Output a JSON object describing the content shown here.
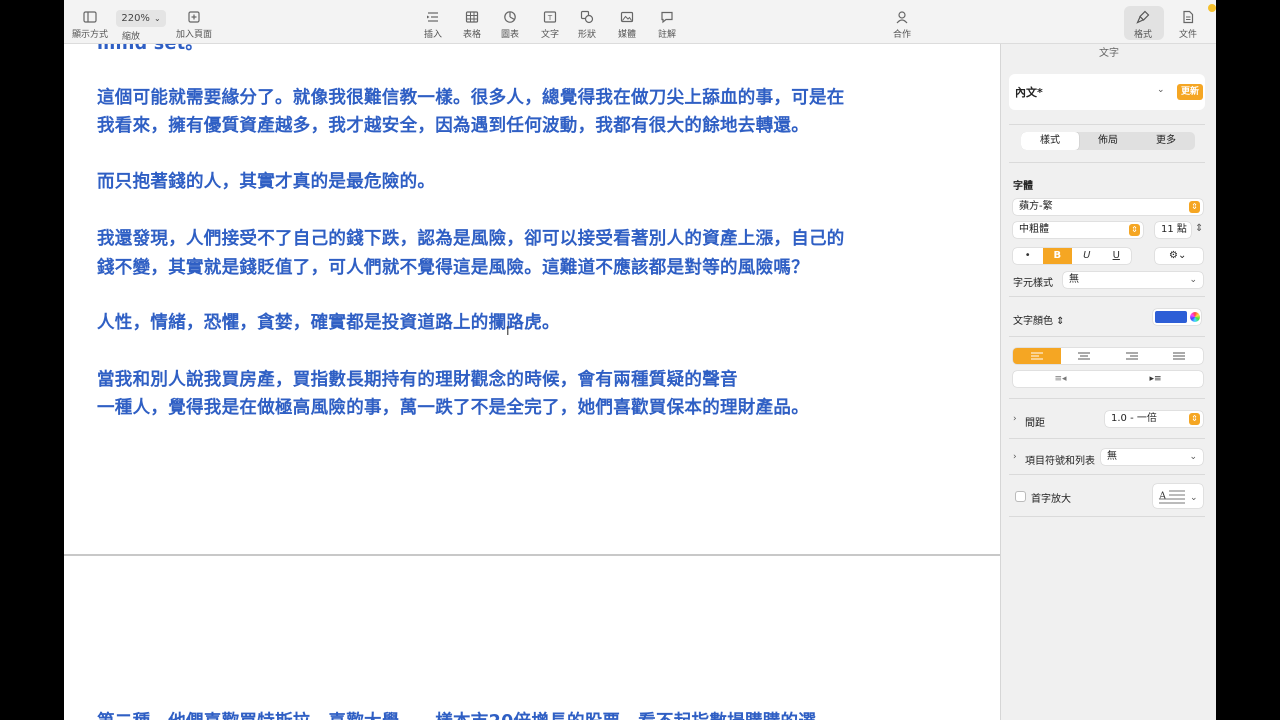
{
  "toolbar": {
    "zoom": "220%",
    "items": {
      "view": "顯示方式",
      "zoom": "縮放",
      "add_page": "加入頁面",
      "insert": "插入",
      "table": "表格",
      "chart": "圖表",
      "text": "文字",
      "shape": "形狀",
      "media": "媒體",
      "comment": "註解",
      "collaborate": "合作",
      "format": "格式",
      "document": "文件"
    }
  },
  "document": {
    "partial_top": "mind set。",
    "paragraphs": [
      "這個可能就需要緣分了。就像我很難信教一樣。很多人，總覺得我在做刀尖上舔血的事，可是在",
      "我看來，擁有優質資產越多，我才越安全，因為遇到任何波動，我都有很大的餘地去轉還。",
      "而只抱著錢的人，其實才真的是最危險的。",
      "我還發現，人們接受不了自己的錢下跌，認為是風險，卻可以接受看著別人的資產上漲，自己的",
      "錢不變，其實就是錢貶值了，可人們就不覺得這是風險。這難道不應該都是對等的風險嗎？",
      "人性，情緒，恐懼，貪婪，確實都是投資道路上的攔路虎。",
      "當我和別人說我買房產，買指數長期持有的理財觀念的時候，會有兩種質疑的聲音",
      "一種人，覺得我是在做極高風險的事，萬一跌了不是全完了，她們喜歡買保本的理財產品。"
    ],
    "partial_bottom": "第二種，他們喜歡買特斯拉，喜歡大學……樣本市20倍增長的股票，看不起指數場購購的選"
  },
  "sidebar": {
    "header": "文字",
    "paragraph_style": "內文*",
    "update_label": "更新",
    "tabs": [
      "樣式",
      "佈局",
      "更多"
    ],
    "font_section": "字體",
    "font_family": "蘋方-繁",
    "font_weight": "中粗體",
    "font_size": "11 點",
    "biu": [
      "•",
      "B",
      "U",
      "U"
    ],
    "char_style_label": "字元樣式",
    "char_style_value": "無",
    "text_color_label": "文字顏色",
    "text_color": "#2d5ed6",
    "spacing_label": "間距",
    "spacing_value": "1.0 - 一倍",
    "bullets_label": "項目符號和列表",
    "bullets_value": "無",
    "dropcap_label": "首字放大"
  },
  "colors": {
    "accent": "#f5a623",
    "body_text": "#2f5fc4"
  }
}
